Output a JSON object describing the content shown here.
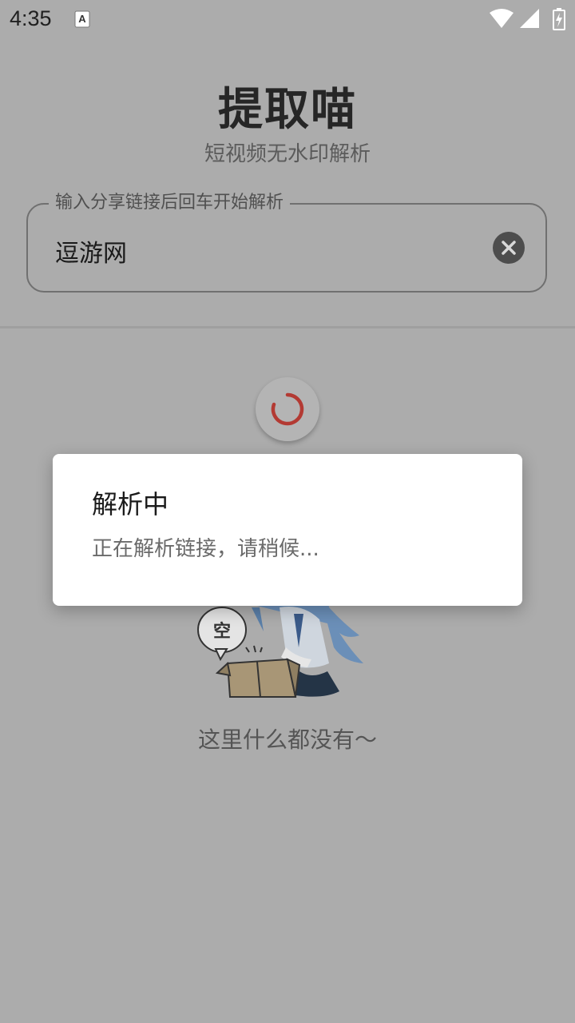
{
  "status_bar": {
    "time": "4:35",
    "icons": [
      "notification-a-icon",
      "wifi-icon",
      "signal-icon",
      "battery-charging-icon"
    ]
  },
  "header": {
    "title": "提取喵",
    "subtitle": "短视频无水印解析"
  },
  "search": {
    "label": "输入分享链接后回车开始解析",
    "value": "逗游网",
    "clear_icon": "close-icon"
  },
  "empty_state": {
    "bubble_text": "空",
    "text": "这里什么都没有～"
  },
  "dialog": {
    "title": "解析中",
    "message": "正在解析链接，请稍候..."
  },
  "colors": {
    "scrim_background": "#acacac",
    "spinner": "#c0392b",
    "dialog_background": "#ffffff"
  }
}
